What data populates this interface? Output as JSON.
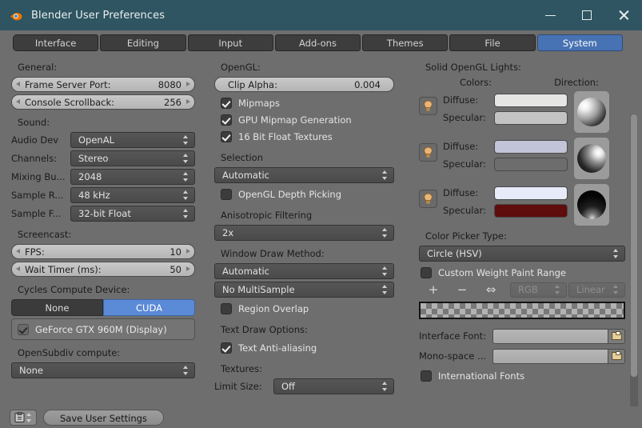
{
  "window": {
    "title": "Blender User Preferences",
    "logo_icon": "blender-logo-icon",
    "minimize_label": "–",
    "maximize_label": "□",
    "close_label": "×",
    "accent_titlebar": "#2e5561",
    "accent_active": "#4772b3"
  },
  "tabs": [
    {
      "label": "Interface",
      "active": false
    },
    {
      "label": "Editing",
      "active": false
    },
    {
      "label": "Input",
      "active": false
    },
    {
      "label": "Add-ons",
      "active": false
    },
    {
      "label": "Themes",
      "active": false
    },
    {
      "label": "File",
      "active": false
    },
    {
      "label": "System",
      "active": true
    }
  ],
  "left_column": {
    "general_header": "General:",
    "frame_server_port": {
      "label": "Frame Server Port:",
      "value": "8080"
    },
    "console_scrollback": {
      "label": "Console Scrollback:",
      "value": "256"
    },
    "sound_header": "Sound:",
    "audio_device": {
      "label": "Audio Dev",
      "value": "OpenAL"
    },
    "channels": {
      "label": "Channels:",
      "value": "Stereo"
    },
    "mixing_buffer": {
      "label": "Mixing Bu...",
      "value": "2048"
    },
    "sample_rate": {
      "label": "Sample R...",
      "value": "48 kHz"
    },
    "sample_format": {
      "label": "Sample F...",
      "value": "32-bit Float"
    },
    "screencast_header": "Screencast:",
    "fps": {
      "label": "FPS:",
      "value": "10"
    },
    "wait_timer": {
      "label": "Wait Timer (ms):",
      "value": "50"
    },
    "cycles_header": "Cycles Compute Device:",
    "cycles_none": "None",
    "cycles_cuda": "CUDA",
    "cycles_active": "CUDA",
    "device": {
      "label": "GeForce GTX 960M (Display)",
      "checked": true
    },
    "opensubdiv_header": "OpenSubdiv compute:",
    "opensubdiv": {
      "value": "None"
    }
  },
  "middle_column": {
    "opengl_header": "OpenGL:",
    "clip_alpha": {
      "label": "Clip Alpha:",
      "value": "0.004"
    },
    "mipmaps": {
      "label": "Mipmaps",
      "checked": true
    },
    "gpu_mipmap": {
      "label": "GPU Mipmap Generation",
      "checked": true
    },
    "float_textures": {
      "label": "16 Bit Float Textures",
      "checked": true
    },
    "selection_header": "Selection",
    "selection": {
      "value": "Automatic"
    },
    "depth_picking": {
      "label": "OpenGL Depth Picking",
      "checked": false
    },
    "aniso_header": "Anisotropic Filtering",
    "aniso": {
      "value": "2x"
    },
    "draw_method_header": "Window Draw Method:",
    "draw_method": {
      "value": "Automatic"
    },
    "multisample": {
      "value": "No MultiSample"
    },
    "region_overlap": {
      "label": "Region Overlap",
      "checked": false
    },
    "text_draw_header": "Text Draw Options:",
    "text_aa": {
      "label": "Text Anti-aliasing",
      "checked": true
    },
    "textures_header": "Textures:",
    "limit_size": {
      "label": "Limit Size:",
      "value": "Off"
    }
  },
  "right_column": {
    "lights_header": "Solid OpenGL Lights:",
    "colors_header": "Colors:",
    "direction_header": "Direction:",
    "lights": [
      {
        "bulb_icon": "lightbulb-icon",
        "diffuse_label": "Diffuse:",
        "diffuse_color": "#e5e5e3",
        "specular_label": "Specular:",
        "specular_color": "#c3c3c3",
        "sphere_highlight": "upper-left",
        "sphere_base": "#1a1a1a"
      },
      {
        "bulb_icon": "lightbulb-icon",
        "diffuse_label": "Diffuse:",
        "diffuse_color": "#c2c4d8",
        "specular_label": "Specular:",
        "specular_color": "#6d6d6d",
        "sphere_highlight": "upper-right",
        "sphere_base": "#101010"
      },
      {
        "bulb_icon": "lightbulb-icon",
        "diffuse_label": "Diffuse:",
        "diffuse_color": "#e6eaf9",
        "specular_label": "Specular:",
        "specular_color": "#5e0c0c",
        "sphere_highlight": "bottom",
        "sphere_base": "#080808"
      }
    ],
    "color_picker_header": "Color Picker Type:",
    "color_picker": {
      "value": "Circle (HSV)"
    },
    "weight_paint": {
      "label": "Custom Weight Paint Range",
      "checked": false
    },
    "ramp_add": "+",
    "ramp_remove": "−",
    "ramp_flip": "⇔",
    "ramp_mode": {
      "value": "RGB",
      "disabled": true
    },
    "ramp_interp": {
      "value": "Linear",
      "disabled": true
    },
    "interface_font": {
      "label": "Interface Font:",
      "value": "",
      "icon": "folder-open-icon"
    },
    "mono_font": {
      "label": "Mono-space ...",
      "value": "",
      "icon": "folder-open-icon"
    },
    "international_fonts": {
      "label": "International Fonts",
      "checked": false
    }
  },
  "footer": {
    "preset_icon": "preset-dropdown-icon",
    "save_label": "Save User Settings"
  }
}
